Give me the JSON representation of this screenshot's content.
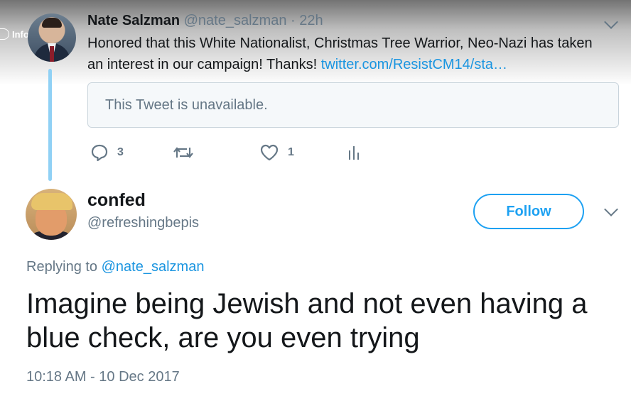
{
  "overlay": {
    "info_label": "Info"
  },
  "reply_tweet": {
    "author_name": "Nate Salzman",
    "author_handle": "@nate_salzman",
    "time_ago": "· 22h",
    "text_line1": "Honored that this White Nationalist, Christmas Tree Warrior, Neo-Nazi has taken",
    "text_line2": "an interest in our campaign! Thanks!",
    "link": "twitter.com/ResistCM14/sta…",
    "quoted_tweet": "This Tweet is unavailable.",
    "actions": {
      "reply_count": "3",
      "retweet_count": "",
      "like_count": "1"
    }
  },
  "main_tweet": {
    "author_name": "confed",
    "author_handle": "@refreshingbepis",
    "follow_label": "Follow",
    "replying_prefix": "Replying to",
    "replying_to": "@nate_salzman",
    "text": "Imagine being Jewish and not even having a blue check, are you even trying",
    "timestamp": "10:18 AM - 10 Dec 2017"
  },
  "colors": {
    "link_blue": "#1b95e0",
    "accent": "#1da1f2",
    "muted_gray": "#657786",
    "thread_line": "#90d1f5"
  },
  "icons": [
    "info-icon",
    "chevron-down-icon",
    "reply-icon",
    "retweet-icon",
    "like-icon",
    "analytics-icon"
  ]
}
